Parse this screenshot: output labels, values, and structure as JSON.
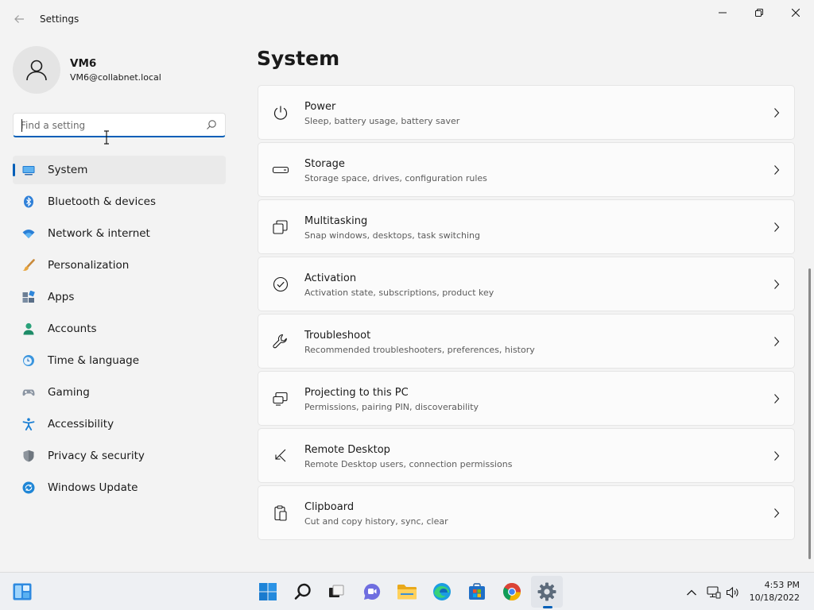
{
  "window": {
    "app_title": "Settings"
  },
  "account": {
    "name": "VM6",
    "email": "VM6@collabnet.local"
  },
  "search": {
    "placeholder": "Find a setting",
    "value": ""
  },
  "nav": {
    "items": [
      {
        "label": "System",
        "icon": "system-display-icon",
        "active": true
      },
      {
        "label": "Bluetooth & devices",
        "icon": "bluetooth-icon"
      },
      {
        "label": "Network & internet",
        "icon": "wifi-icon"
      },
      {
        "label": "Personalization",
        "icon": "paintbrush-icon"
      },
      {
        "label": "Apps",
        "icon": "apps-grid-icon"
      },
      {
        "label": "Accounts",
        "icon": "person-icon"
      },
      {
        "label": "Time & language",
        "icon": "clock-globe-icon"
      },
      {
        "label": "Gaming",
        "icon": "gamepad-icon"
      },
      {
        "label": "Accessibility",
        "icon": "accessibility-icon"
      },
      {
        "label": "Privacy & security",
        "icon": "shield-icon"
      },
      {
        "label": "Windows Update",
        "icon": "update-icon"
      }
    ]
  },
  "main": {
    "title": "System",
    "cards": [
      {
        "title": "Power",
        "subtitle": "Sleep, battery usage, battery saver",
        "icon": "power-icon"
      },
      {
        "title": "Storage",
        "subtitle": "Storage space, drives, configuration rules",
        "icon": "storage-drive-icon"
      },
      {
        "title": "Multitasking",
        "subtitle": "Snap windows, desktops, task switching",
        "icon": "multitasking-icon"
      },
      {
        "title": "Activation",
        "subtitle": "Activation state, subscriptions, product key",
        "icon": "check-circle-icon"
      },
      {
        "title": "Troubleshoot",
        "subtitle": "Recommended troubleshooters, preferences, history",
        "icon": "wrench-icon"
      },
      {
        "title": "Projecting to this PC",
        "subtitle": "Permissions, pairing PIN, discoverability",
        "icon": "projector-icon"
      },
      {
        "title": "Remote Desktop",
        "subtitle": "Remote Desktop users, connection permissions",
        "icon": "remote-desktop-icon"
      },
      {
        "title": "Clipboard",
        "subtitle": "Cut and copy history, sync, clear",
        "icon": "clipboard-icon"
      }
    ]
  },
  "taskbar": {
    "apps": [
      {
        "name": "start",
        "icon": "windows-start-icon"
      },
      {
        "name": "search",
        "icon": "search-icon"
      },
      {
        "name": "task-view",
        "icon": "task-view-icon"
      },
      {
        "name": "chat",
        "icon": "teams-chat-icon"
      },
      {
        "name": "file-explorer",
        "icon": "folder-icon"
      },
      {
        "name": "edge",
        "icon": "edge-icon"
      },
      {
        "name": "store",
        "icon": "store-icon"
      },
      {
        "name": "chrome",
        "icon": "chrome-icon"
      },
      {
        "name": "settings",
        "icon": "gear-icon",
        "active": true
      }
    ],
    "time": "4:53 PM",
    "date": "10/18/2022"
  },
  "colors": {
    "accent": "#005fb8",
    "background": "#f3f3f3",
    "card": "#fbfbfb",
    "taskbar": "#eef0f3"
  }
}
